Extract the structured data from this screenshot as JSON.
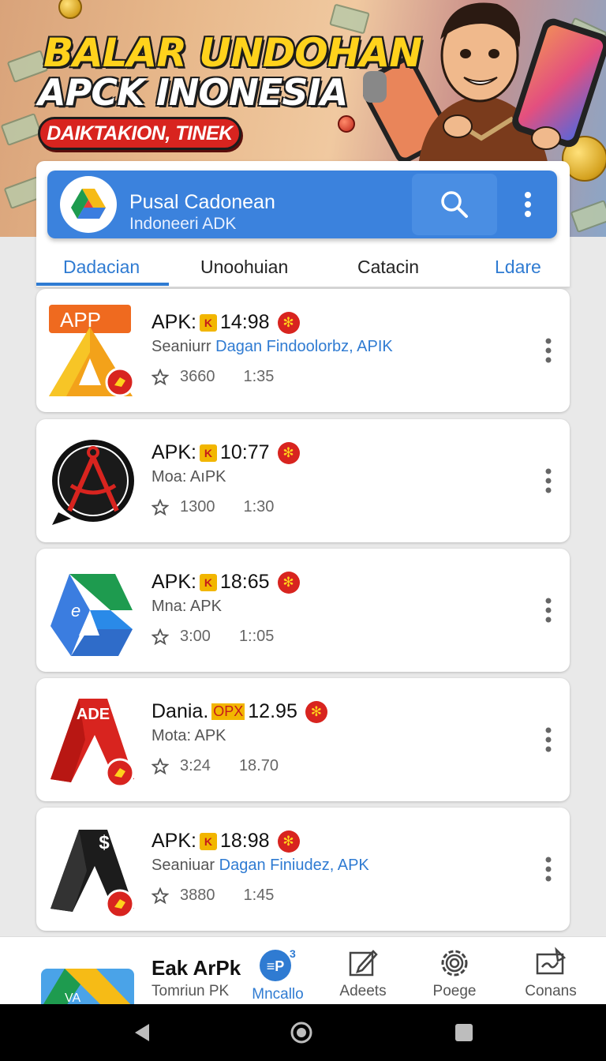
{
  "banner": {
    "title_line1": "BALAR UNDOHAN",
    "title_line2": "APCK INONESIA",
    "pill_text": "DAIKTAKION, TINEK"
  },
  "appbar": {
    "title": "Pusal Cadonean",
    "subtitle": "Indoneeri ADK",
    "search_icon": "search-icon",
    "more_icon": "more-vertical-icon"
  },
  "tabs": [
    {
      "label": "Dadacian",
      "active": true
    },
    {
      "label": "Unoohuian",
      "active": false
    },
    {
      "label": "Catacin",
      "active": false
    },
    {
      "label": "Ldare",
      "active": false
    }
  ],
  "items": [
    {
      "title_prefix": "APK:",
      "version": "14:98",
      "subtitle_gray": "Seaniurr ",
      "subtitle_blue": "Dagan Findoolorbz, APIK",
      "rating": "3660",
      "duration": "1:35",
      "icon_text": "APP"
    },
    {
      "title_prefix": "APK:",
      "version": "10:77",
      "subtitle_gray": "Moa: AıPK",
      "subtitle_blue": "",
      "rating": "1300",
      "duration": "1:30",
      "icon_text": ""
    },
    {
      "title_prefix": "APK:",
      "version": "18:65",
      "subtitle_gray": "Mna: APK",
      "subtitle_blue": "",
      "rating": "3:00",
      "duration": "1::05",
      "icon_text": ""
    },
    {
      "title_prefix": "Dania.",
      "version": "12.95",
      "title_badge": "OPX",
      "subtitle_gray": "Mota: APK",
      "subtitle_blue": "",
      "rating": "3:24",
      "duration": "18.70",
      "icon_text": "ADE"
    },
    {
      "title_prefix": "APK:",
      "version": "18:98",
      "subtitle_gray": "Seaniuar ",
      "subtitle_blue": "Dagan Finiudez, APK",
      "rating": "3880",
      "duration": "1:45",
      "icon_text": "$"
    }
  ],
  "bottomnav": {
    "app_name": "Eak ArPk",
    "app_sub": "Tomriun PK",
    "buttons": [
      {
        "label": "Mncallo",
        "icon": "download-badge-icon",
        "active": true
      },
      {
        "label": "Adeets",
        "icon": "edit-icon",
        "active": false
      },
      {
        "label": "Poege",
        "icon": "settings-icon",
        "active": false
      },
      {
        "label": "Conans",
        "icon": "signature-icon",
        "active": false
      }
    ]
  },
  "system_nav": {
    "back": "back-icon",
    "home": "home-icon",
    "recents": "recents-icon"
  },
  "colors": {
    "primary": "#3b82dd",
    "tab_active": "#2f7bd2",
    "accent_red": "#d8241f",
    "accent_gold": "#f2b600"
  }
}
